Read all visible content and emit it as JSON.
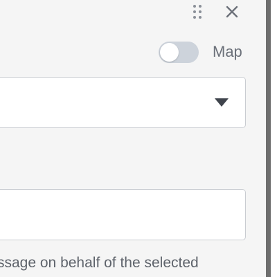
{
  "header": {
    "drag_icon": "drag-handle-icon",
    "close_icon": "close-icon"
  },
  "map_toggle": {
    "label": "Map",
    "checked": false,
    "track_color": "#cdd3db"
  },
  "select": {
    "value": "",
    "arrow_icon": "caret-down-icon"
  },
  "text_field": {
    "value": ""
  },
  "helper": {
    "text": "ssage on behalf of the selected"
  },
  "colors": {
    "panel_bg": "#f5f5f5",
    "border": "#c9ccd1",
    "icon": "#6b7079"
  }
}
